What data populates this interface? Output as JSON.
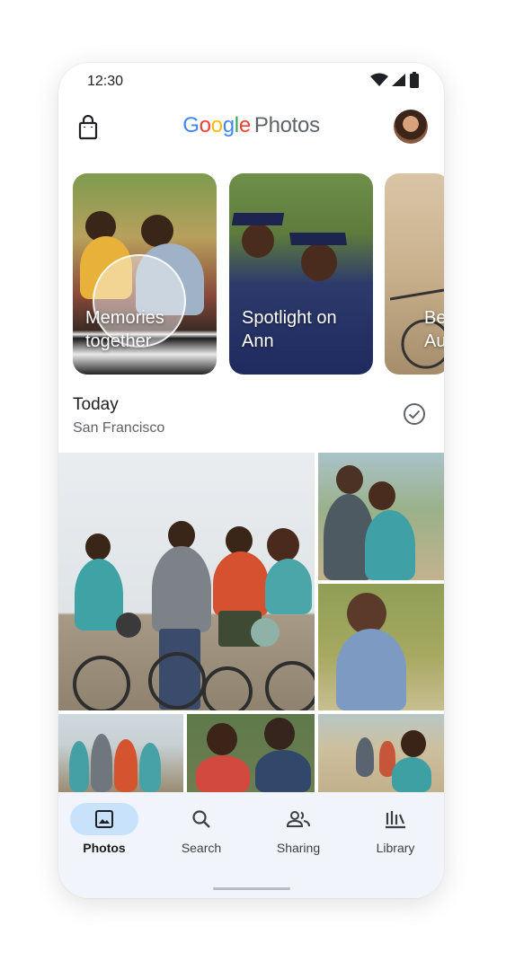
{
  "status_bar": {
    "time": "12:30"
  },
  "header": {
    "logo": {
      "letters": [
        "G",
        "o",
        "o",
        "g",
        "l",
        "e"
      ],
      "colors": [
        "#4285F4",
        "#EA4335",
        "#FBBC05",
        "#4285F4",
        "#34A853",
        "#EA4335"
      ],
      "photos": "Photos"
    }
  },
  "memories": [
    {
      "line1": "Memories",
      "line2": "together"
    },
    {
      "line1": "Spotlight on",
      "line2": "Ann"
    },
    {
      "line1": "Be",
      "line2": "Au"
    }
  ],
  "section": {
    "title": "Today",
    "location": "San Francisco"
  },
  "nav": {
    "items": [
      {
        "label": "Photos",
        "icon": "image-icon"
      },
      {
        "label": "Search",
        "icon": "search-icon"
      },
      {
        "label": "Sharing",
        "icon": "people-icon"
      },
      {
        "label": "Library",
        "icon": "library-icon"
      }
    ],
    "active": "Photos",
    "active_color": "#c9e2fb"
  }
}
